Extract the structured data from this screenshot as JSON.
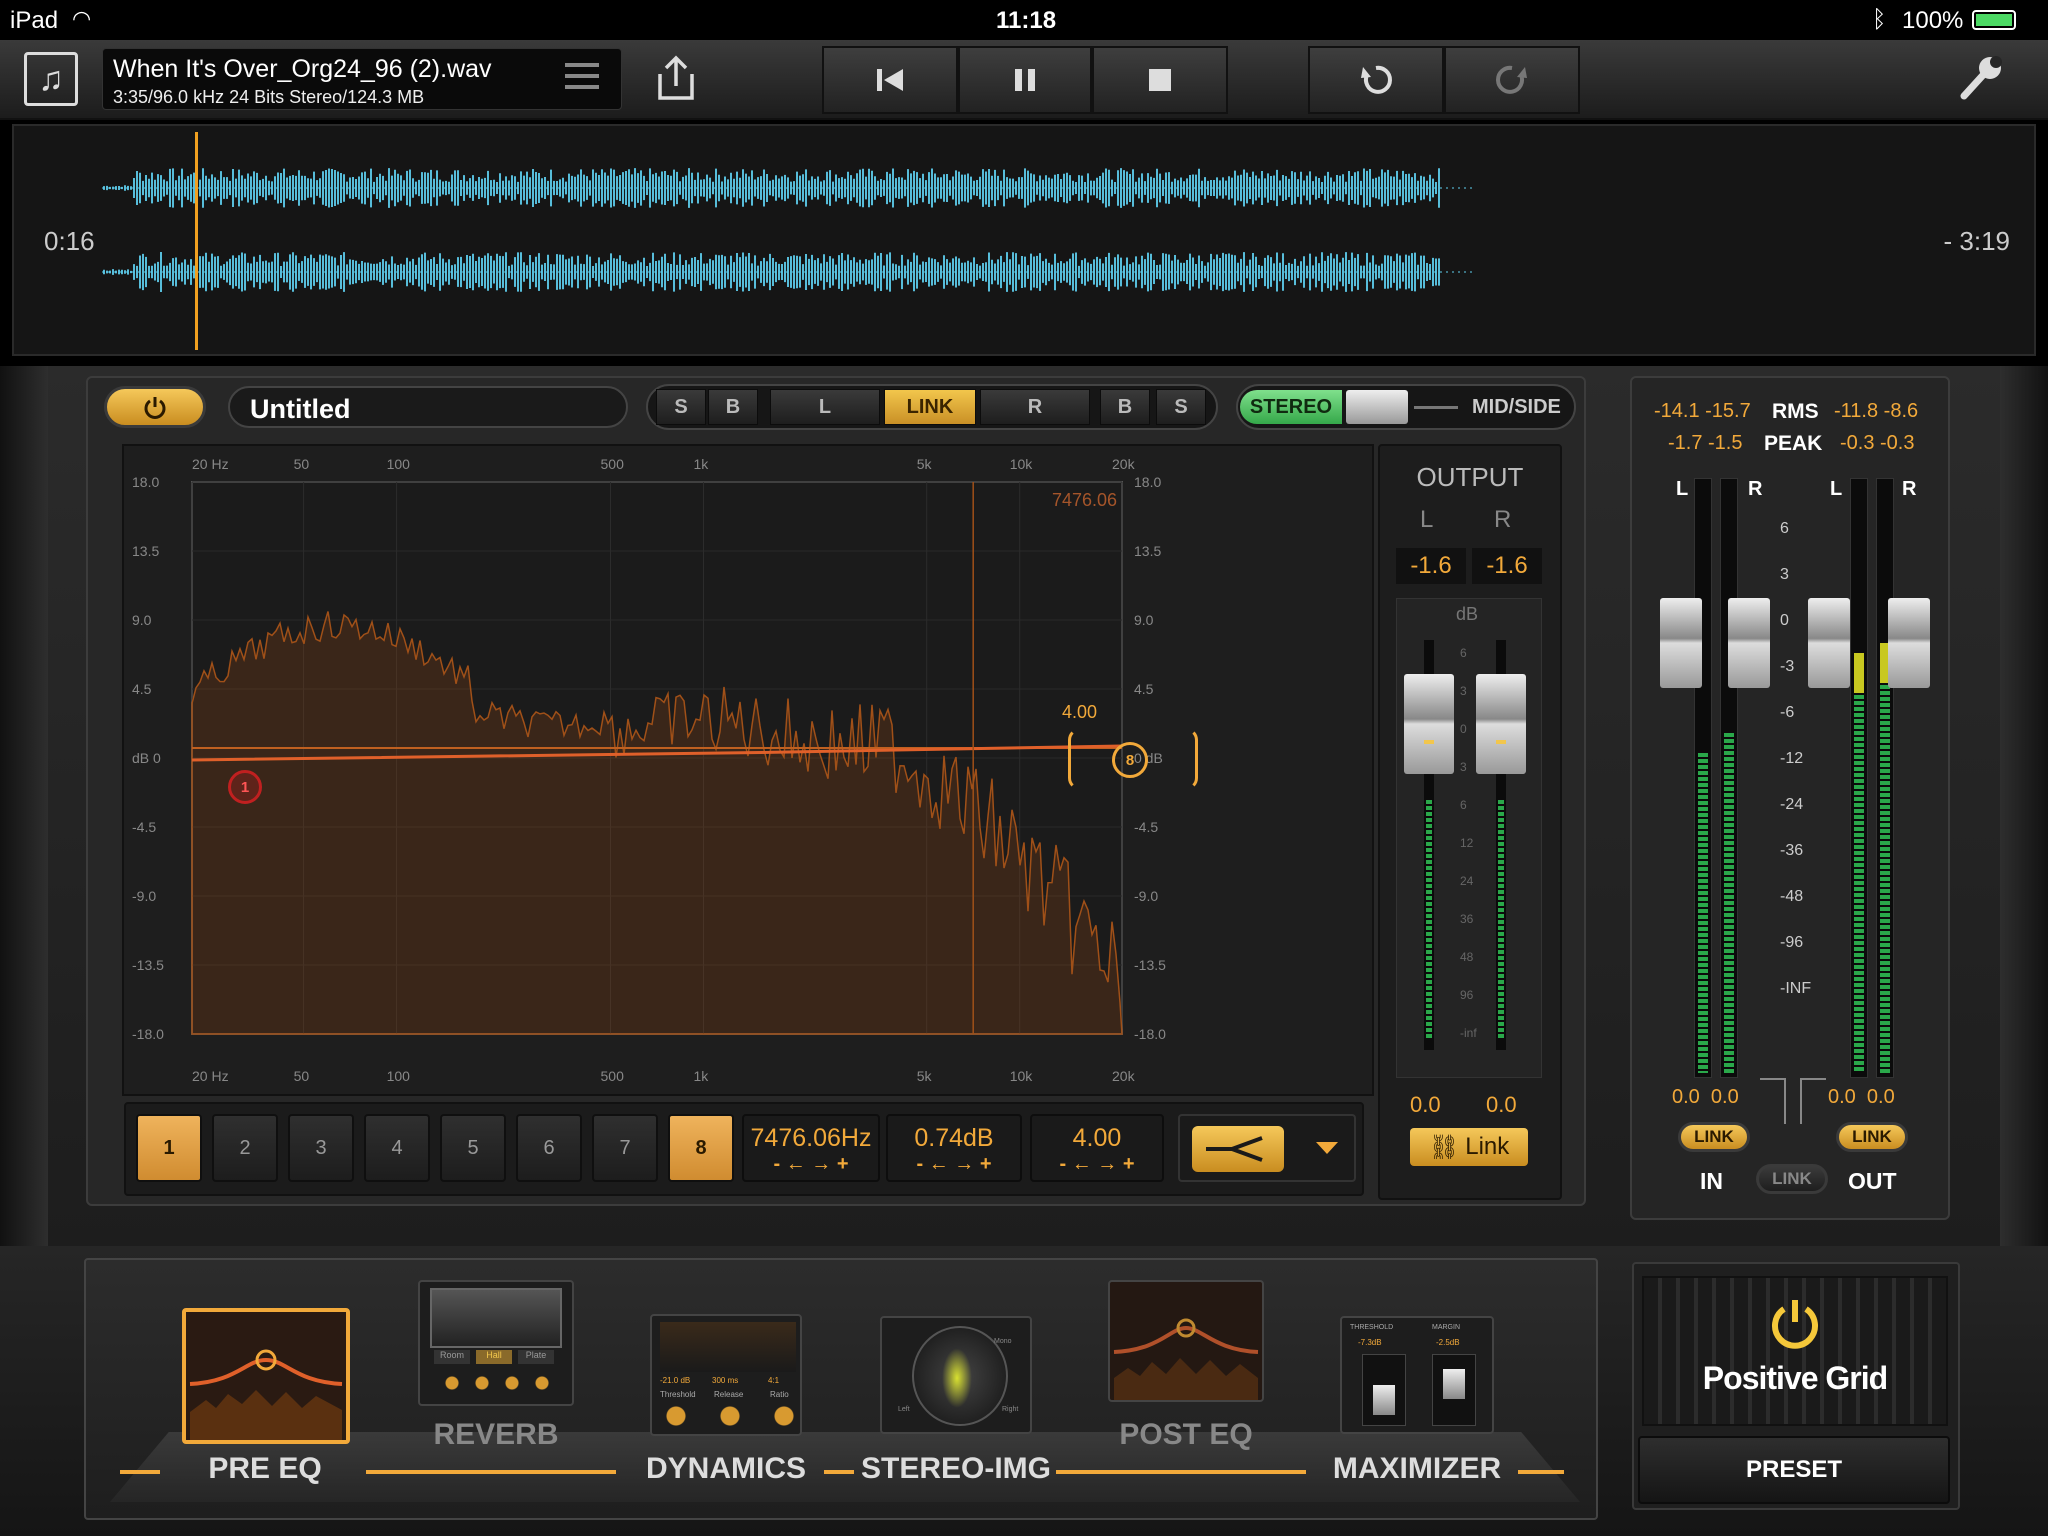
{
  "status": {
    "device": "iPad",
    "time": "11:18",
    "battery": "100%"
  },
  "file": {
    "name": "When It's Over_Org24_96 (2).wav",
    "info": "3:35/96.0 kHz 24 Bits Stereo/124.3 MB"
  },
  "waveform": {
    "elapsed": "0:16",
    "remaining": "- 3:19",
    "playhead_fraction": 0.065
  },
  "eq": {
    "preset_name": "Untitled",
    "channel_buttons": [
      "S",
      "B",
      "L",
      "LINK",
      "R",
      "B",
      "S"
    ],
    "stereo_label": "STEREO",
    "midside_label": "MID/SIDE",
    "freq_ticks": [
      "20 Hz",
      "50",
      "100",
      "500",
      "1k",
      "5k",
      "10k",
      "20k"
    ],
    "db_ticks_left": [
      "18.0",
      "13.5",
      "9.0",
      "4.5",
      "dB 0",
      "-4.5",
      "-9.0",
      "-13.5",
      "-18.0"
    ],
    "db_ticks_right": [
      "18.0",
      "13.5",
      "9.0",
      "4.5",
      "0 dB",
      "-4.5",
      "-9.0",
      "-13.5",
      "-18.0"
    ],
    "marker_freq": "7476.06",
    "node_q": "4.00",
    "node1": "1",
    "node8": "8",
    "bands": [
      "1",
      "2",
      "3",
      "4",
      "5",
      "6",
      "7",
      "8"
    ],
    "freq_value": "7476.06Hz",
    "gain_value": "0.74dB",
    "q_value": "4.00",
    "stepper_label": "- ← → +"
  },
  "output": {
    "title": "OUTPUT",
    "l": "L",
    "r": "R",
    "l_val": "-1.6",
    "r_val": "-1.6",
    "db_label": "dB",
    "scale": [
      "6",
      "3",
      "0",
      "3",
      "6",
      "12",
      "24",
      "36",
      "48",
      "96",
      "-inf"
    ],
    "bottom_l": "0.0",
    "bottom_r": "0.0",
    "link": "Link"
  },
  "meters": {
    "rms_label": "RMS",
    "peak_label": "PEAK",
    "rms_in": "-14.1 -15.7",
    "rms_out": "-11.8 -8.6",
    "peak_in": "-1.7 -1.5",
    "peak_out": "-0.3 -0.3",
    "l": "L",
    "r": "R",
    "scale": [
      "6",
      "3",
      "0",
      "-3",
      "-6",
      "-12",
      "-24",
      "-36",
      "-48",
      "-96",
      "-INF"
    ],
    "in_vals": "0.0  0.0",
    "out_vals": "0.0  0.0",
    "link": "LINK",
    "in": "IN",
    "out": "OUT"
  },
  "modules": [
    "PRE EQ",
    "REVERB",
    "DYNAMICS",
    "STEREO-IMG",
    "POST EQ",
    "MAXIMIZER"
  ],
  "reverb_tabs": [
    "Room",
    "Hall",
    "Plate"
  ],
  "dynamics_vals": [
    "-21.0 dB",
    "300 ms",
    "4:1"
  ],
  "dynamics_knobs": [
    "Threshold",
    "Release",
    "Ratio"
  ],
  "max_labels": [
    "THRESHOLD",
    "MARGIN"
  ],
  "max_vals": [
    "-7.3dB",
    "-2.5dB"
  ],
  "stereo_img_corners": [
    "Mono",
    "Left",
    "Right"
  ],
  "brand": "Positive Grid",
  "preset": "PRESET",
  "colors": {
    "accent": "#f2a93a",
    "wave": "#5fd0f0",
    "curve": "#e0602a",
    "green": "#3bd26a"
  }
}
